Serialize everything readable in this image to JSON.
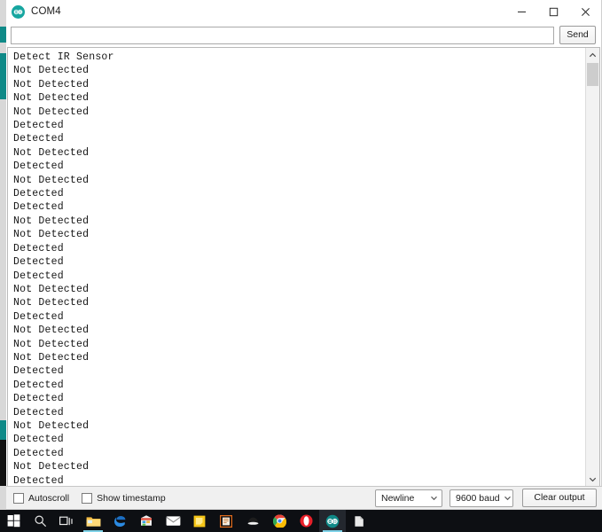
{
  "window": {
    "title": "COM4",
    "logo_icon": "arduino-logo-icon",
    "controls": [
      {
        "name": "minimize-button",
        "icon": "minimize-icon"
      },
      {
        "name": "maximize-button",
        "icon": "maximize-icon"
      },
      {
        "name": "close-button",
        "icon": "close-icon"
      }
    ]
  },
  "send_row": {
    "input_value": "",
    "input_placeholder": "",
    "send_label": "Send"
  },
  "console": {
    "lines": [
      "Detect IR Sensor",
      "Not Detected",
      "Not Detected",
      "Not Detected",
      "Not Detected",
      "Detected",
      "Detected",
      "Not Detected",
      "Detected",
      "Not Detected",
      "Detected",
      "Detected",
      "Not Detected",
      "Not Detected",
      "Detected",
      "Detected",
      "Detected",
      "Not Detected",
      "Not Detected",
      "Detected",
      "Not Detected",
      "Not Detected",
      "Not Detected",
      "Detected",
      "Detected",
      "Detected",
      "Detected",
      "Not Detected",
      "Detected",
      "Detected",
      "Not Detected",
      "Detected"
    ]
  },
  "scrollbar": {
    "up_icon": "chevron-up-icon",
    "down_icon": "chevron-down-icon"
  },
  "toolbar": {
    "autoscroll_label": "Autoscroll",
    "autoscroll_checked": false,
    "timestamp_label": "Show timestamp",
    "timestamp_checked": false,
    "line_ending": "Newline",
    "baud_rate": "9600 baud",
    "clear_label": "Clear output",
    "dropdown_icon": "chevron-down-icon"
  },
  "taskbar": {
    "items": [
      {
        "name": "taskbar-start-button",
        "icon": "windows-start-icon"
      },
      {
        "name": "taskbar-search-button",
        "icon": "search-icon"
      },
      {
        "name": "taskbar-task-view-button",
        "icon": "task-view-icon"
      },
      {
        "name": "taskbar-file-explorer",
        "icon": "folder-icon"
      },
      {
        "name": "taskbar-edge-browser",
        "icon": "edge-icon"
      },
      {
        "name": "taskbar-microsoft-store",
        "icon": "store-icon"
      },
      {
        "name": "taskbar-mail-app",
        "icon": "mail-icon"
      },
      {
        "name": "taskbar-app-yellow",
        "icon": "yellow-app-icon"
      },
      {
        "name": "taskbar-sticky-notes",
        "icon": "sticky-notes-icon"
      },
      {
        "name": "taskbar-app-orange",
        "icon": "orange-app-icon"
      },
      {
        "name": "taskbar-app-dark",
        "icon": "dark-app-icon"
      },
      {
        "name": "taskbar-chrome-browser",
        "icon": "chrome-icon"
      },
      {
        "name": "taskbar-opera-browser",
        "icon": "opera-icon"
      },
      {
        "name": "taskbar-arduino-ide",
        "icon": "arduino-logo-icon"
      },
      {
        "name": "taskbar-app-document",
        "icon": "document-app-icon"
      }
    ]
  },
  "colors": {
    "accent_teal": "#0f8a88",
    "arduino_teal": "#17a6a0",
    "toolbar_bg": "#f0f0f0",
    "taskbar_bg": "#0d0f13"
  }
}
